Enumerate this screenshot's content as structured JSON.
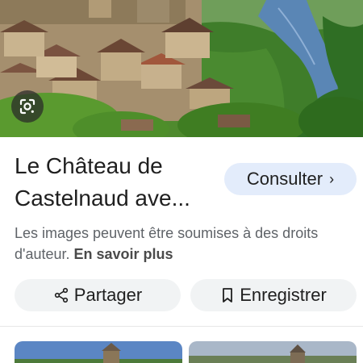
{
  "result": {
    "title": "Le Château de Castelnaud ave...",
    "consult_label": "Consulter",
    "copyright_text": "Les images peuvent être soumises à des droits d'auteur. ",
    "learn_more_label": "En savoir plus"
  },
  "actions": {
    "share_label": "Partager",
    "save_label": "Enregistrer"
  },
  "colors": {
    "consult_bg": "#e3ecfb",
    "action_bg": "#f1f3f4",
    "text_primary": "#1f1f1f",
    "text_secondary": "#5f6368"
  },
  "icons": {
    "lens": "google-lens-icon",
    "consult_arrow": "chevron-right-icon",
    "share": "share-icon",
    "save": "bookmark-icon"
  }
}
